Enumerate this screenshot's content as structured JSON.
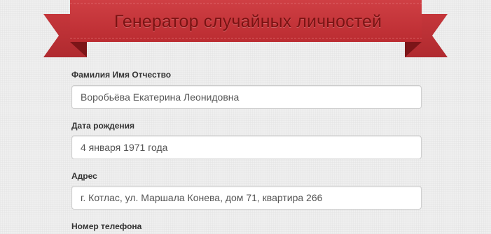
{
  "header": {
    "title": "Генератор случайных личностей"
  },
  "fields": [
    {
      "label": "Фамилия Имя Отчество",
      "value": "Воробьёва Екатерина Леонидовна"
    },
    {
      "label": "Дата рождения",
      "value": "4 января 1971 года"
    },
    {
      "label": "Адрес",
      "value": "г. Котлас, ул. Маршала Конева, дом 71, квартира 266"
    },
    {
      "label": "Номер телефона",
      "value": ""
    }
  ],
  "colors": {
    "ribbon_main": "#c9363b",
    "ribbon_dark": "#8f1c20",
    "title_text": "#7a1313",
    "background": "#efefef"
  }
}
